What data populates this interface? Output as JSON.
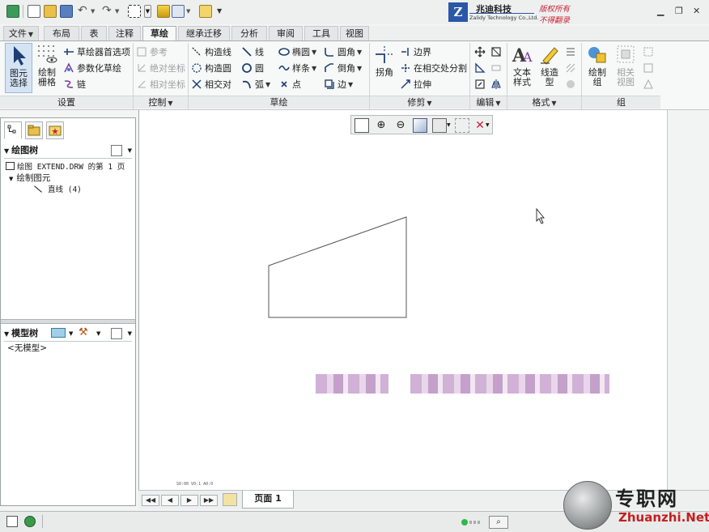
{
  "logo": {
    "company_cn": "兆迪科技",
    "company_en": "Zalidy Technology Co.,Ltd.",
    "rights1": "版权所有",
    "rights2": "不得翻录"
  },
  "tabs": [
    {
      "label": "文件",
      "active": false
    },
    {
      "label": "布局",
      "active": false
    },
    {
      "label": "表",
      "active": false
    },
    {
      "label": "注释",
      "active": false
    },
    {
      "label": "草绘",
      "active": true
    },
    {
      "label": "继承迁移",
      "active": false
    },
    {
      "label": "分析",
      "active": false
    },
    {
      "label": "审阅",
      "active": false
    },
    {
      "label": "工具",
      "active": false
    },
    {
      "label": "视图",
      "active": false
    }
  ],
  "ribbon": {
    "select_label": "图元选择",
    "grid_label": "绘制栅格",
    "sketcher_prefs": "草绘器首选项",
    "param_sketch": "参数化草绘",
    "chain": "链",
    "reference": "参考",
    "abs_coord": "绝对坐标",
    "rel_coord": "相对坐标",
    "construct_line": "构造线",
    "construct_circle": "构造圆",
    "intersect": "相交对",
    "line": "线",
    "circle": "圆",
    "arc": "弧",
    "ellipse": "椭圆",
    "spline": "样条",
    "point": "点",
    "fillet": "圆角",
    "chamfer": "倒角",
    "edge": "边",
    "corner": "拐角",
    "boundary": "边界",
    "split_at_intersect": "在相交处分割",
    "stretch": "拉伸",
    "text_style": "文本样式",
    "line_style": "线造型",
    "draw_group": "绘制组",
    "related_view": "相关视图",
    "groups": [
      "设置",
      "控制",
      "草绘",
      "修剪",
      "编辑",
      "格式",
      "组"
    ]
  },
  "drawing_tree": {
    "title": "绘图树",
    "root": "绘图 EXTEND.DRW 的第 1 页",
    "node": "绘制图元",
    "leaf": "直线 (4)"
  },
  "model_tree": {
    "title": "模型树",
    "empty": "<无模型>"
  },
  "page_nav": {
    "page_label": "页面 1"
  },
  "tiny_status": "S0:00  V0:1  A0:0",
  "watermark": {
    "cn": "专职网",
    "en": "Zhuanzhi.Net"
  }
}
